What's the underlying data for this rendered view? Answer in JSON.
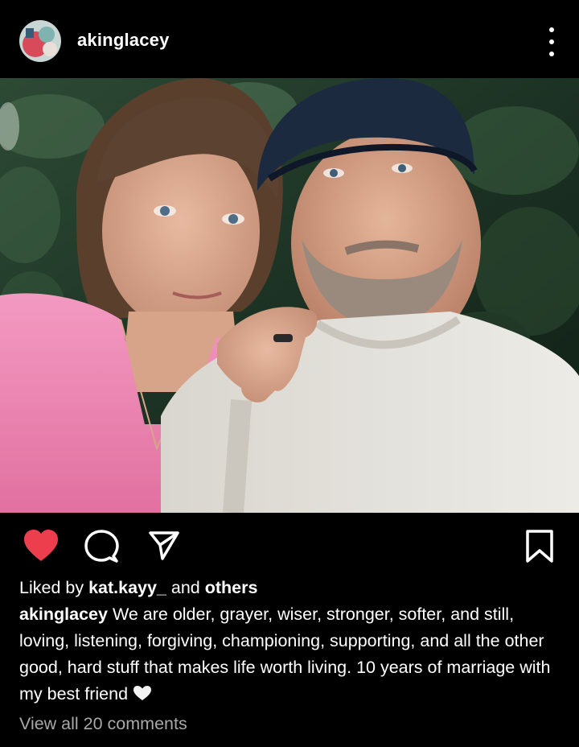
{
  "post": {
    "username": "akinglacey",
    "avatar_icon": "profile-avatar",
    "more_icon": "more-vertical-icon"
  },
  "photo": {
    "icon": "couple-selfie-photo"
  },
  "actions": {
    "like_icon": "heart-filled-icon",
    "like_color": "#ed3e4e",
    "comment_icon": "comment-bubble-icon",
    "share_icon": "paper-plane-icon",
    "save_icon": "bookmark-icon"
  },
  "likes": {
    "prefix": "Liked by ",
    "user": "kat.kayy_",
    "middle": " and ",
    "others": "others"
  },
  "caption": {
    "username": "akinglacey",
    "text": " We are older, grayer, wiser, stronger, softer, and still, loving, listening, forgiving, championing, supporting, and all the other good, hard stuff that makes life worth living.  10 years of marriage with my best friend",
    "emoji_icon": "white-heart-icon"
  },
  "comments": {
    "view_all": "View all 20 comments"
  }
}
